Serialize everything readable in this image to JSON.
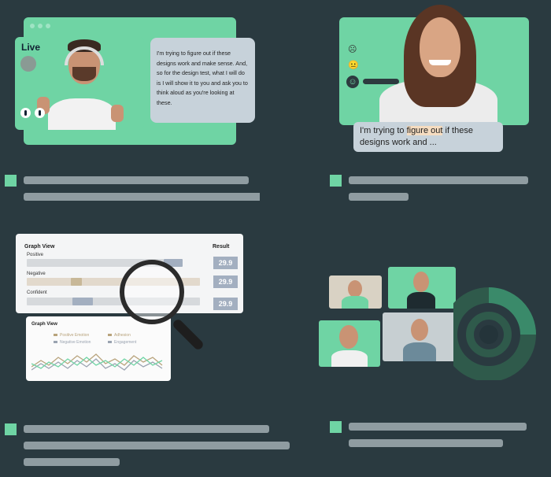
{
  "panel1": {
    "live_label": "Live",
    "transcript": "I'm trying to figure out if these designs work and make sense. And, so for the design test, what I will do is I will show it to you and ask you to think aloud as you're looking at these."
  },
  "panel2": {
    "bubble_pre": "I'm trying to ",
    "bubble_highlight": "figure out",
    "bubble_post": " if these designs work and ..."
  },
  "panel3": {
    "title": "Graph View",
    "result_header": "Result",
    "rows": [
      {
        "label": "Positive",
        "value": "29.9"
      },
      {
        "label": "Negative",
        "value": "29.9"
      },
      {
        "label": "Confident",
        "value": "29.9"
      }
    ],
    "subchart": {
      "title": "Graph View",
      "legend": [
        "Positive Emotion",
        "Adhesion",
        "Negative Emotion",
        "Engagement"
      ]
    }
  },
  "colors": {
    "accent": "#6fd4a4",
    "background": "#2a3a40",
    "bubble": "#c7d2da"
  }
}
